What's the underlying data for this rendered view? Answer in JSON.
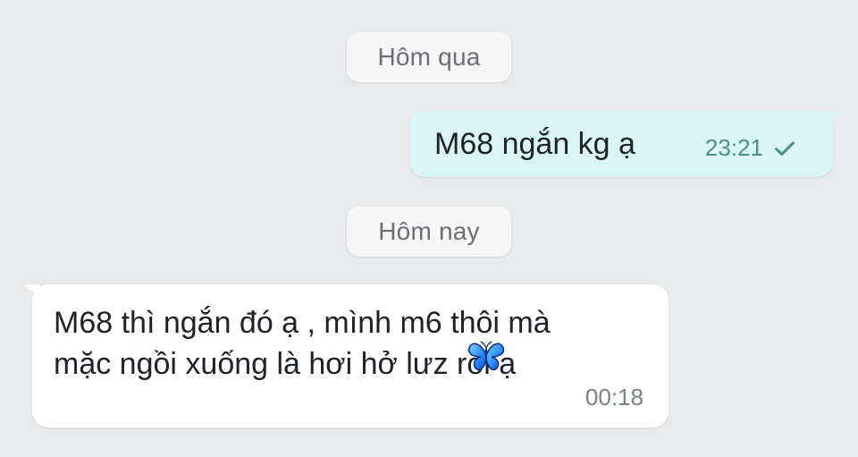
{
  "chat": {
    "date_separators": {
      "yesterday": "Hôm qua",
      "today": "Hôm nay"
    },
    "messages": [
      {
        "direction": "sent",
        "text": "M68 ngắn kg ạ",
        "time": "23:21",
        "status_icon": "check-icon"
      },
      {
        "direction": "received",
        "lines": [
          "M68 thì ngắn đó ạ , mình m6 thôi mà",
          "mặc ngồi xuống là hơi hở lưz rồi ạ"
        ],
        "time": "00:18",
        "sticker_icon": "butterfly-icon"
      }
    ]
  },
  "colors": {
    "background": "#e9eaec",
    "sent_bubble": "#d9f6f5",
    "received_bubble": "#ffffff",
    "meta_text": "#4b8f8d",
    "date_pill_text": "#6b6f75"
  }
}
